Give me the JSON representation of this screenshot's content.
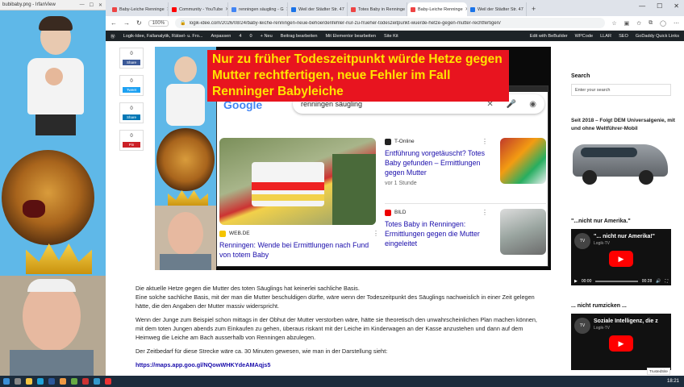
{
  "irfan": {
    "title": "bubibaby.png - IrfanView"
  },
  "tabs": [
    {
      "label": "Baby-Leiche Renninge",
      "color": "#e44"
    },
    {
      "label": "Community - YouTube",
      "color": "#f00"
    },
    {
      "label": "renningen säugling - G",
      "color": "#4285f4"
    },
    {
      "label": "Weil der Städter Str. 47",
      "color": "#1a73e8"
    },
    {
      "label": "Totes Baby in Renninge",
      "color": "#e44"
    },
    {
      "label": "Baby-Leiche Renninge",
      "color": "#e44"
    },
    {
      "label": "Weil der Städter Str. 47",
      "color": "#1a73e8"
    }
  ],
  "nav": {
    "zoom": "100%",
    "url": "logik-idee.com/2026/08/24/baby-leiche-renningen-neue-behoerdenfehler-nur-zu-frueher-todeszeitpunkt-wuerde-hetze-gegen-mutter-rechtfertigen/"
  },
  "wpbar": {
    "items": [
      "Logik-Idee, Fallanalytik, Rätsel- u. Fro...",
      "4",
      "0",
      "+ Neu",
      "Beitrag bearbeiten",
      "Mit Elementor bearbeiten",
      "Site Kit"
    ],
    "right": [
      "Edit with BeBuilder",
      "WPCode",
      "LLAR",
      "SEO",
      "GoDaddy Quick Links"
    ]
  },
  "share": [
    {
      "count": "0",
      "label": "Share",
      "color": "#3b5998"
    },
    {
      "count": "0",
      "label": "Tweet",
      "color": "#1da1f2"
    },
    {
      "count": "0",
      "label": "Share",
      "color": "#0077b5"
    },
    {
      "count": "0",
      "label": "Pin",
      "color": "#cb2027"
    }
  ],
  "hero": {
    "headline": "Nur zu früher Todeszeitpunkt würde Hetze gegen Mutter rechtfertigen, neue Fehler im Fall Renninger Babyleiche",
    "snap_title": "Ashampoo_Snap_2026.08.24_17h45m13s_002_.png",
    "google_logo": "Google",
    "search_query": "renningen säugling",
    "news": [
      {
        "source": "WEB.DE",
        "title": "Renningen: Wende bei Ermittlungen nach Fund von totem Baby",
        "time": "",
        "logo_color": "#f5c400"
      },
      {
        "source": "T-Online",
        "title": "Entführung vorgetäuscht? Totes Baby gefunden – Ermittlungen gegen Mutter",
        "time": "vor 1 Stunde",
        "logo_color": "#222"
      },
      {
        "source": "BILD",
        "title": "Totes Baby in Renningen: Ermittlungen gegen die Mutter eingeleitet",
        "time": "",
        "logo_color": "#e00"
      }
    ]
  },
  "article": {
    "p1": "Die aktuelle Hetze gegen die Mutter des toten Säuglings hat keinerlei sachliche Basis.",
    "p2": "Eine solche sachliche Basis, mit der man die Mutter beschuldigen dürfte, wäre wenn der Todeszeitpunkt des Säuglings nachweislich in einer Zeit gelegen hätte, die den Angaben der Mutter massiv widerspricht.",
    "p3": "Wenn der Junge zum Beispiel schon mittags in der Obhut der Mutter verstorben wäre, hätte sie theoretisch den unwahrscheinlichen Plan machen können, mit dem toten Jungen abends zum Einkaufen zu gehen, überaus riskant mit der Leiche im Kinderwagen an der Kasse anzustehen und dann auf dem Heimweg die Leiche am Bach ausserhalb von Renningen abzulegen.",
    "p4": "Der Zeitbedarf für diese Strecke wäre ca. 30 Minuten gewesen, wie man in der Darstellung sieht:",
    "link": "https://maps.app.goo.gl/NQowWHKYdeAMAqjs5"
  },
  "sidebar": {
    "search_title": "Search",
    "search_placeholder": "Enter your search",
    "since_text": "Seit 2018 – Folgt DEM Universalgenie, mit und ohne Weltführer-Mobil",
    "video1_title": "\"...nicht nur Amerika.\"",
    "video1_label": "\"... nicht nur Amerika!\"",
    "video1_channel": "Logik-TV",
    "video1_time1": "00:00",
    "video1_time2": "00:28",
    "video2_title": "... nicht rumzicken ...",
    "video2_label": "Soziale Intelligenz, die z",
    "video2_channel": "Logik-TV"
  },
  "taskbar": {
    "clock": "18:21",
    "trusted": "TrustedSite"
  }
}
